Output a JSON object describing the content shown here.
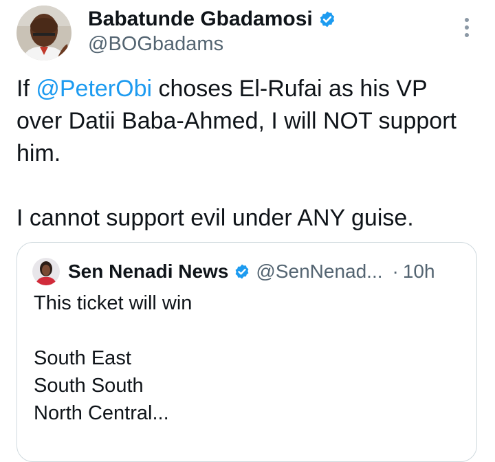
{
  "tweet": {
    "author_name": "Babatunde Gbadamosi",
    "handle": "@BOGbadams",
    "text_before": "If ",
    "mention": "@PeterObi",
    "text_after": " choses El-Rufai as his VP over Datii Baba-Ahmed, I will NOT support him.\n\nI cannot support evil under ANY guise.",
    "verified_icon": "verified-badge-icon",
    "more_icon": "more-vertical-icon"
  },
  "quote": {
    "author_name": "Sen Nenadi News",
    "handle": "@SenNenad...",
    "separator": "·",
    "time": "10h",
    "text": "This ticket will win\n\nSouth East\nSouth South\nNorth Central..."
  },
  "colors": {
    "accent": "#1d9bf0",
    "text": "#0f1419",
    "secondary": "#536471",
    "border": "#cfd9de"
  }
}
